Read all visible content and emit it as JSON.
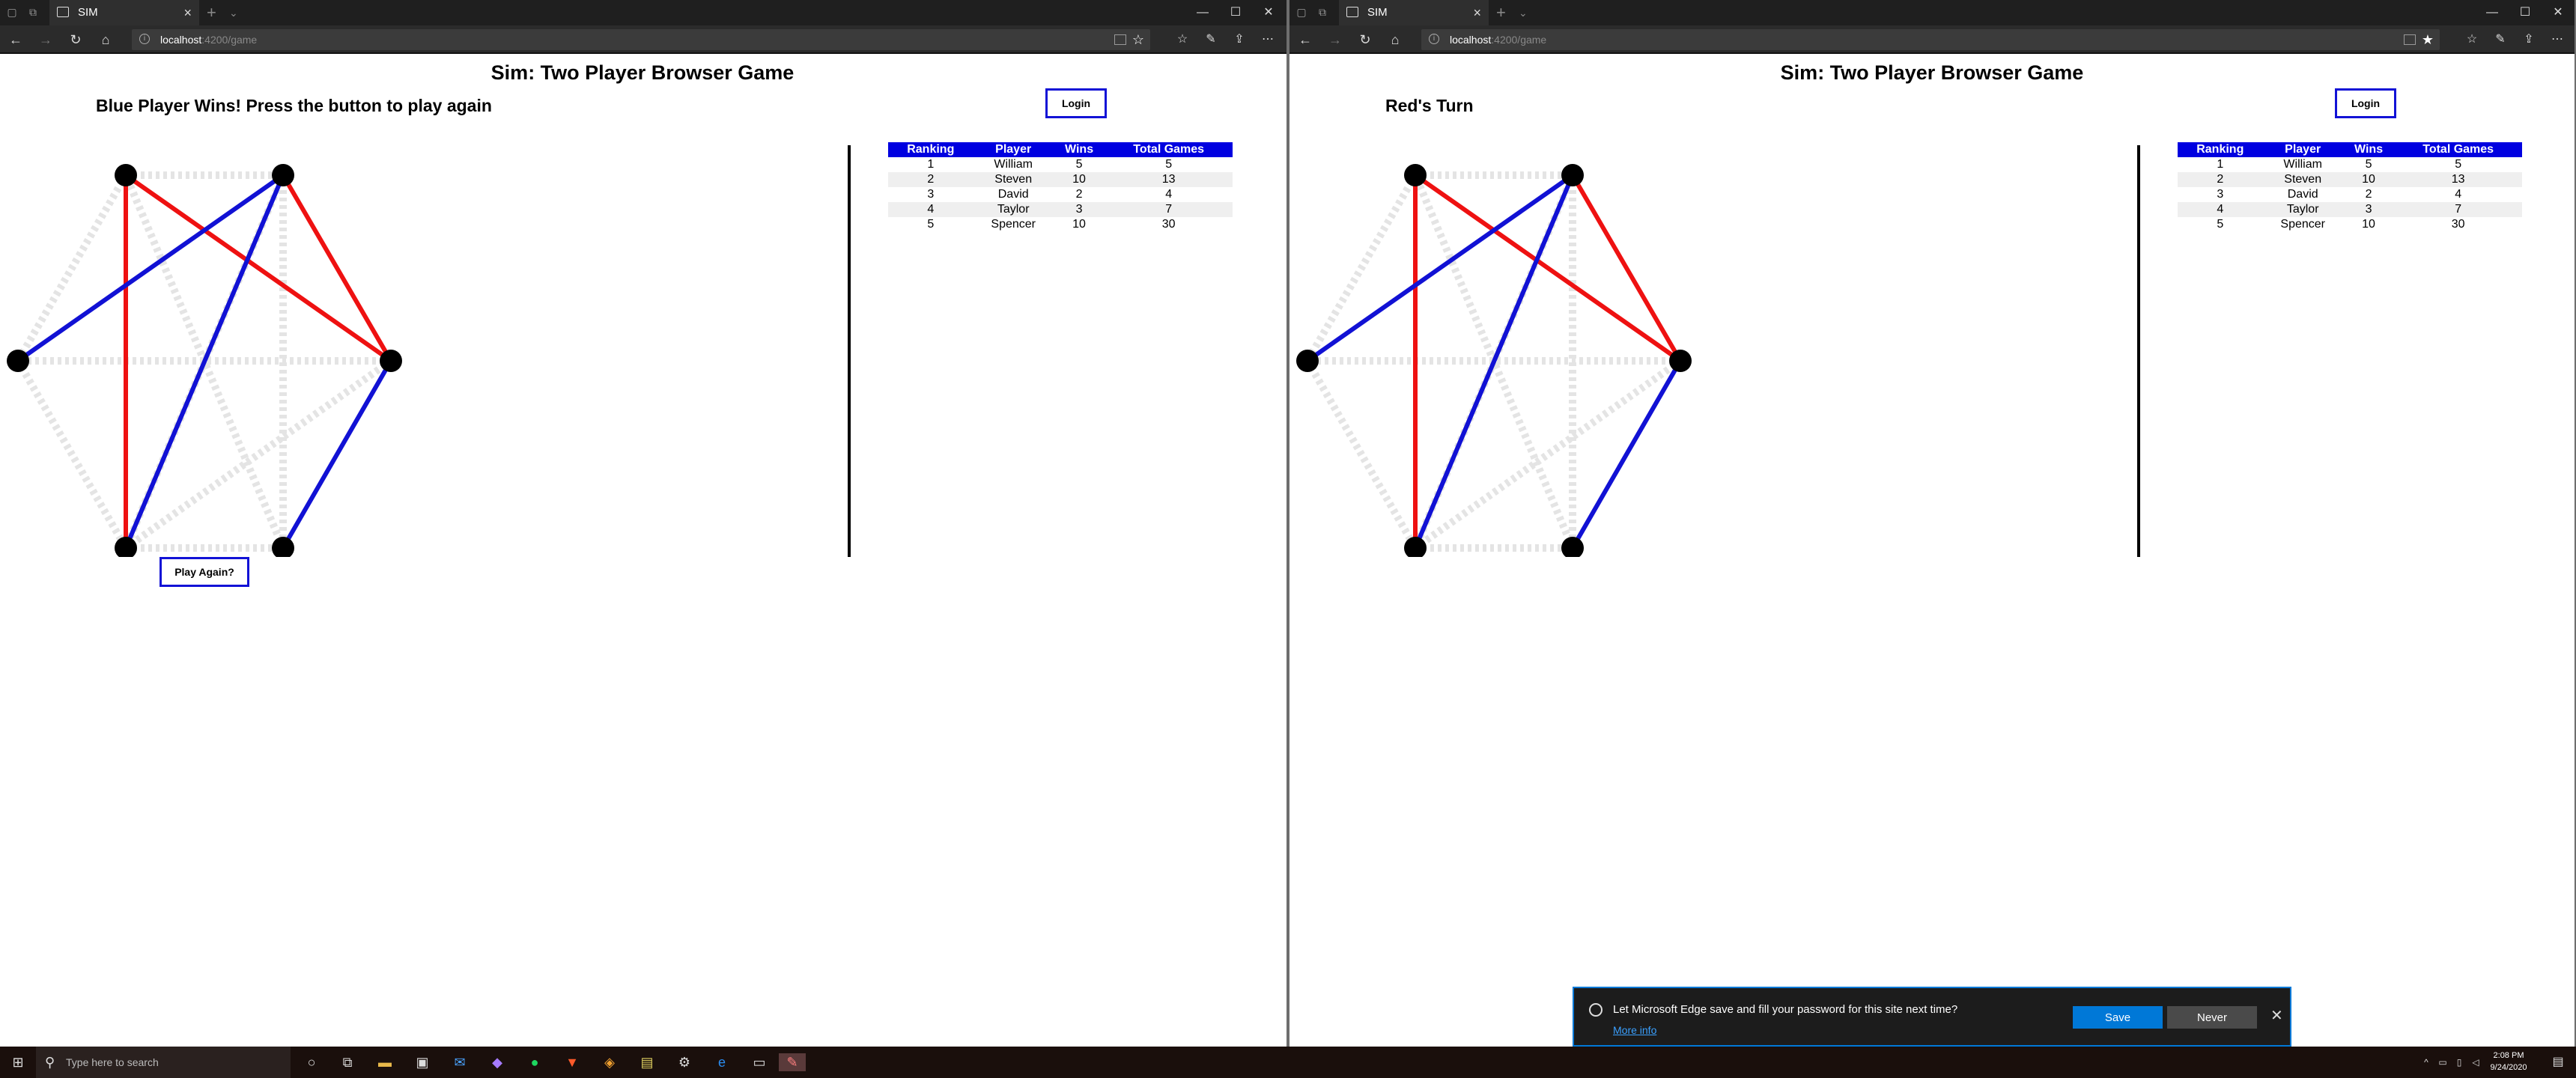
{
  "windows": [
    {
      "tab_title": "SIM",
      "url_host": "localhost",
      "url_rest": ":4200/game",
      "heading": "Sim: Two Player Browser Game",
      "status": "Blue Player Wins! Press the button to play again",
      "login_label": "Login",
      "play_again_label": "Play Again?",
      "show_play_again": true
    },
    {
      "tab_title": "SIM",
      "url_host": "localhost",
      "url_rest": ":4200/game",
      "heading": "Sim: Two Player Browser Game",
      "status": "Red's Turn",
      "login_label": "Login",
      "play_again_label": "",
      "show_play_again": false
    }
  ],
  "game": {
    "colors": {
      "red": "#ee1111",
      "blue": "#1111d4",
      "unclaimed": "#e4e4e4",
      "node": "#000000"
    },
    "nodes": [
      "A",
      "B",
      "C",
      "D",
      "E",
      "F"
    ],
    "edges_red": [
      [
        "A",
        "C"
      ],
      [
        "A",
        "E"
      ],
      [
        "B",
        "C"
      ]
    ],
    "edges_blue": [
      [
        "B",
        "E"
      ],
      [
        "B",
        "D"
      ],
      [
        "F",
        "C"
      ]
    ],
    "edges_unclaimed": [
      [
        "A",
        "B"
      ],
      [
        "C",
        "D"
      ],
      [
        "D",
        "E"
      ],
      [
        "E",
        "F"
      ],
      [
        "F",
        "A"
      ],
      [
        "A",
        "D"
      ],
      [
        "B",
        "F"
      ],
      [
        "C",
        "E"
      ],
      [
        "B",
        "E"
      ]
    ]
  },
  "leaderboard": {
    "headers": [
      "Ranking",
      "Player",
      "Wins",
      "Total Games"
    ],
    "rows": [
      [
        "1",
        "William",
        "5",
        "5"
      ],
      [
        "2",
        "Steven",
        "10",
        "13"
      ],
      [
        "3",
        "David",
        "2",
        "4"
      ],
      [
        "4",
        "Taylor",
        "3",
        "7"
      ],
      [
        "5",
        "Spencer",
        "10",
        "30"
      ]
    ]
  },
  "edge_prompt": {
    "message": "Let Microsoft Edge save and fill your password for this site next time?",
    "more_info": "More info",
    "save": "Save",
    "never": "Never"
  },
  "taskbar": {
    "search_placeholder": "Type here to search",
    "time": "2:08 PM",
    "date": "9/24/2020"
  }
}
